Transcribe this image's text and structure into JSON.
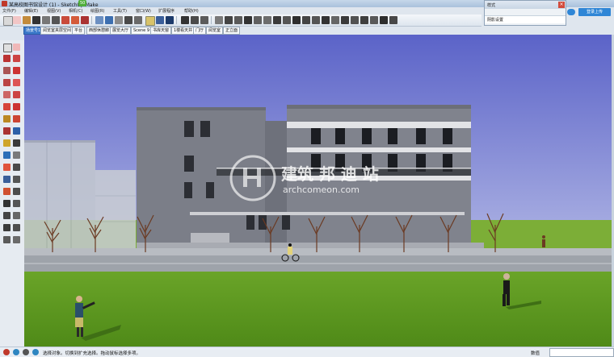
{
  "window": {
    "title": "某高校图书馆设计 (1) - SketchUp Make",
    "badge": "50",
    "colors": {
      "sky_top": "#5b63c8",
      "sky_bottom": "#d7dbf1",
      "grass": "#5c9a1f",
      "building": "#7b7e88"
    }
  },
  "menu": [
    "文件(F)",
    "编辑(E)",
    "视图(V)",
    "相机(C)",
    "绘图(R)",
    "工具(T)",
    "窗口(W)",
    "扩展程序",
    "帮助(H)"
  ],
  "scenes": [
    "场景号1",
    "阅览室夹层空间",
    "平台",
    "西部休憩廊",
    "展览大厅",
    "Scene 9",
    "书库天窗",
    "1楼看天井",
    "门厅",
    "阅览室",
    "正立面"
  ],
  "panel": {
    "title": "样式",
    "close": "×",
    "row": "阴影设置"
  },
  "login": {
    "label": "登录上传"
  },
  "viewport": {
    "watermark_main": "建筑 邦 迪 站",
    "watermark_sub": "archcomeon.com"
  },
  "status": {
    "hint": "选择对象。切换到扩充选择。拖动鼠标选择多项。",
    "measure_label": "数值",
    "measure_value": ""
  },
  "icons": {
    "toolbar": [
      "select-icon",
      "eraser-icon",
      "paint-icon",
      "line-icon",
      "rectangle-icon",
      "push-pull-icon",
      "move-icon",
      "rotate-icon",
      "offset-icon",
      "tape-icon",
      "text-icon",
      "orbit-icon",
      "pan-icon",
      "zoom-icon",
      "zoom-extents-icon",
      "warehouse-icon",
      "extension-icon",
      "layout-icon",
      "section-icon",
      "style-icon",
      "shadow-icon",
      "fog-icon",
      "camera-icon",
      "walk-icon",
      "look-icon"
    ],
    "left": [
      "select-icon",
      "eraser-icon",
      "line-icon",
      "arc-icon",
      "rectangle-icon",
      "circle-icon",
      "polygon-icon",
      "freehand-icon",
      "push-pull-icon",
      "follow-me-icon",
      "offset-icon",
      "scale-icon",
      "move-icon",
      "rotate-icon",
      "tape-icon",
      "protractor-icon",
      "dimension-icon",
      "axes-icon",
      "text-icon",
      "3d-text-icon",
      "orbit-icon",
      "pan-icon",
      "zoom-icon",
      "zoom-window-icon",
      "zoom-extents-icon",
      "previous-view-icon",
      "position-camera-icon",
      "walk-icon",
      "look-around-icon",
      "section-plane-icon"
    ]
  }
}
